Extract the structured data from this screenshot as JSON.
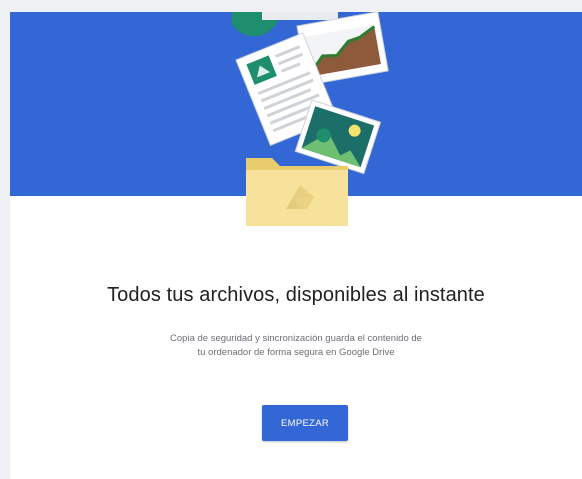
{
  "onboarding": {
    "headline": "Todos tus archivos, disponibles al instante",
    "description_line1": "Copia de seguridad y sincronización guarda el contenido de",
    "description_line2": "tu ordenador de forma segura en Google Drive",
    "start_button_label": "EMPEZAR"
  },
  "theme": {
    "hero_background": "#3367d6",
    "button_background": "#3367d6",
    "folder_color": "#f7e29c"
  },
  "icons": [
    "file-icon-round",
    "chart-document-icon",
    "text-document-icon",
    "photo-icon",
    "google-drive-folder-icon",
    "google-drive-logo-icon"
  ]
}
